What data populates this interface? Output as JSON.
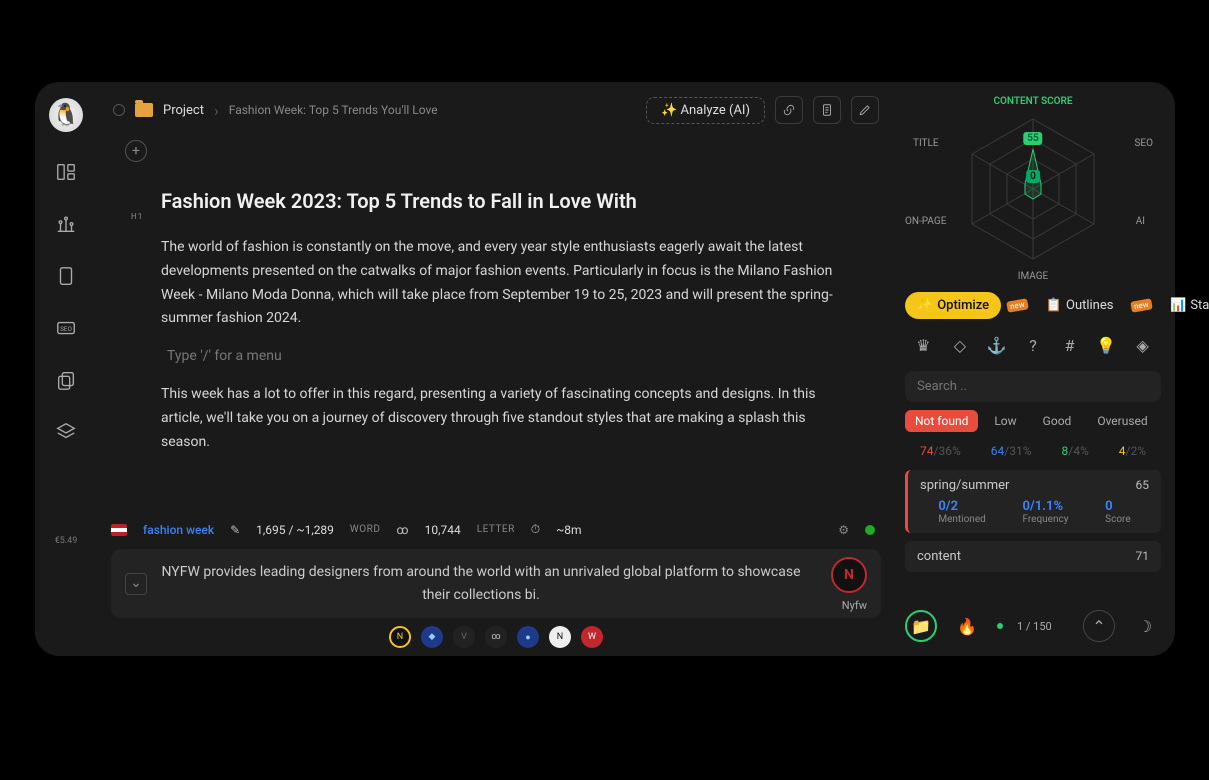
{
  "rail": {
    "version": "€5.49"
  },
  "breadcrumb": {
    "project_label": "Project",
    "doc_title": "Fashion Week: Top 5 Trends You'll Love"
  },
  "toolbar": {
    "analyze_label": "✨ Analyze (AI)"
  },
  "editor": {
    "heading_prefix": "H1",
    "title": "Fashion Week 2023: Top 5 Trends to Fall in Love With",
    "p1": "The world of fashion is constantly on the move, and every year style enthusiasts eagerly await the latest developments presented on the catwalks of major fashion events. Particularly in focus is the Milano Fashion Week - Milano Moda Donna, which will take place from September 19 to 25, 2023 and will present the spring-summer fashion 2024.",
    "slash_hint": "Type '/' for a menu",
    "p2": "This week has a lot to offer in this regard, presenting a variety of fascinating concepts and designs. In this article, we'll take you on a journey of discovery through five standout styles that are making a splash this season."
  },
  "stats": {
    "keyword": "fashion week",
    "words_current": "1,695",
    "words_target": "~1,289",
    "words_label": "WORD",
    "letters": "10,744",
    "letters_label": "LETTER",
    "read_time": "~8m"
  },
  "suggestion": {
    "text": "NYFW provides leading designers from around the world with an unrivaled global platform to showcase their collections bi.",
    "source": "Nyfw"
  },
  "radar": {
    "labels": {
      "top": "CONTENT SCORE",
      "tl": "TITLE",
      "tr": "SEO",
      "bl": "ON-PAGE",
      "br": "AI",
      "bottom": "IMAGE"
    },
    "score_main": "55",
    "score_sub": "0"
  },
  "panel_tabs": {
    "optimize": "Optimize",
    "outlines": "Outlines",
    "statics": "Statics"
  },
  "search_placeholder": "Search ..",
  "filters": {
    "not_found": "Not found",
    "low": "Low",
    "good": "Good",
    "overused": "Overused"
  },
  "counts": {
    "nf": "74",
    "nf_pct": "/36%",
    "low": "64",
    "low_pct": "/31%",
    "good": "8",
    "good_pct": "/4%",
    "over": "4",
    "over_pct": "/2%"
  },
  "keywords": [
    {
      "term": "spring/summer",
      "score": "65",
      "mentioned": "0/2",
      "mentioned_label": "Mentioned",
      "freq": "0/1.1%",
      "freq_label": "Frequency",
      "kscore": "0",
      "kscore_label": "Score"
    },
    {
      "term": "content",
      "score": "71"
    }
  ],
  "footer": {
    "counter": "1 / 150"
  }
}
